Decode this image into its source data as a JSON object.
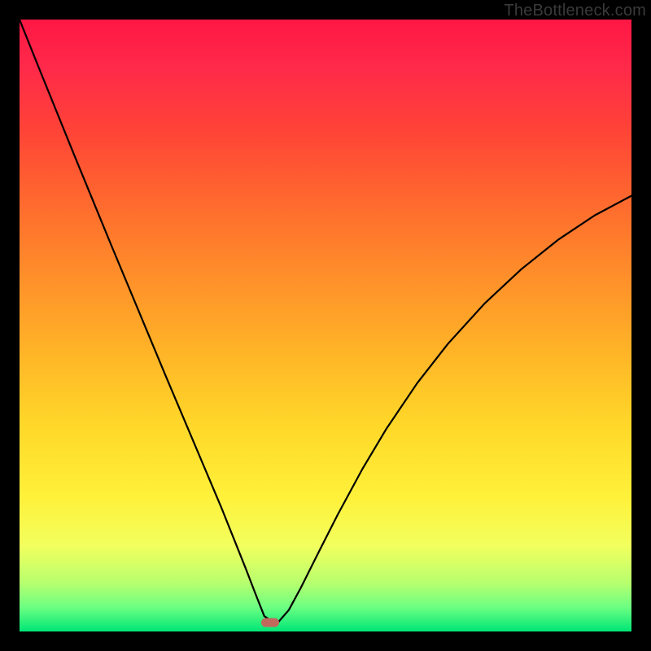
{
  "watermark": "TheBottleneck.com",
  "chart_data": {
    "type": "line",
    "title": "",
    "xlabel": "",
    "ylabel": "",
    "xlim": [
      0,
      100
    ],
    "ylim": [
      0,
      100
    ],
    "grid": false,
    "series": [
      {
        "name": "curve",
        "x": [
          0,
          3,
          6,
          9,
          12,
          15,
          18,
          21,
          24,
          27,
          30,
          33,
          35,
          37,
          38.5,
          40,
          42,
          44,
          46,
          49,
          52,
          56,
          60,
          65,
          70,
          76,
          82,
          88,
          94,
          100
        ],
        "values": [
          100,
          92.5,
          85.1,
          77.7,
          70.4,
          63.1,
          55.9,
          48.7,
          41.5,
          34.4,
          27.3,
          20.2,
          15.2,
          10.2,
          6.3,
          2.5,
          1.2,
          3.5,
          7.2,
          13.2,
          19.1,
          26.5,
          33.2,
          40.6,
          47.0,
          53.6,
          59.2,
          64.0,
          68.0,
          71.2
        ]
      }
    ],
    "marker": {
      "x": 41,
      "y": 1.5
    },
    "background_gradient_stops": [
      {
        "pos": 0,
        "color": "#ff1744"
      },
      {
        "pos": 18,
        "color": "#ff4337"
      },
      {
        "pos": 42,
        "color": "#ff8f2a"
      },
      {
        "pos": 66,
        "color": "#ffd729"
      },
      {
        "pos": 86,
        "color": "#f2ff5e"
      },
      {
        "pos": 100,
        "color": "#00e676"
      }
    ]
  }
}
